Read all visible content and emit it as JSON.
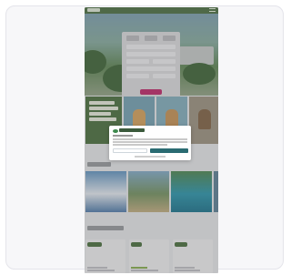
{
  "colors": {
    "accent": "#c23b76",
    "brand_green": "#5a7a4f",
    "teal_button": "#2a6b72",
    "frame_background": "#f7f7f9"
  },
  "icons": {
    "menu": "hamburger-menu-icon",
    "logo": "brand-logo"
  }
}
